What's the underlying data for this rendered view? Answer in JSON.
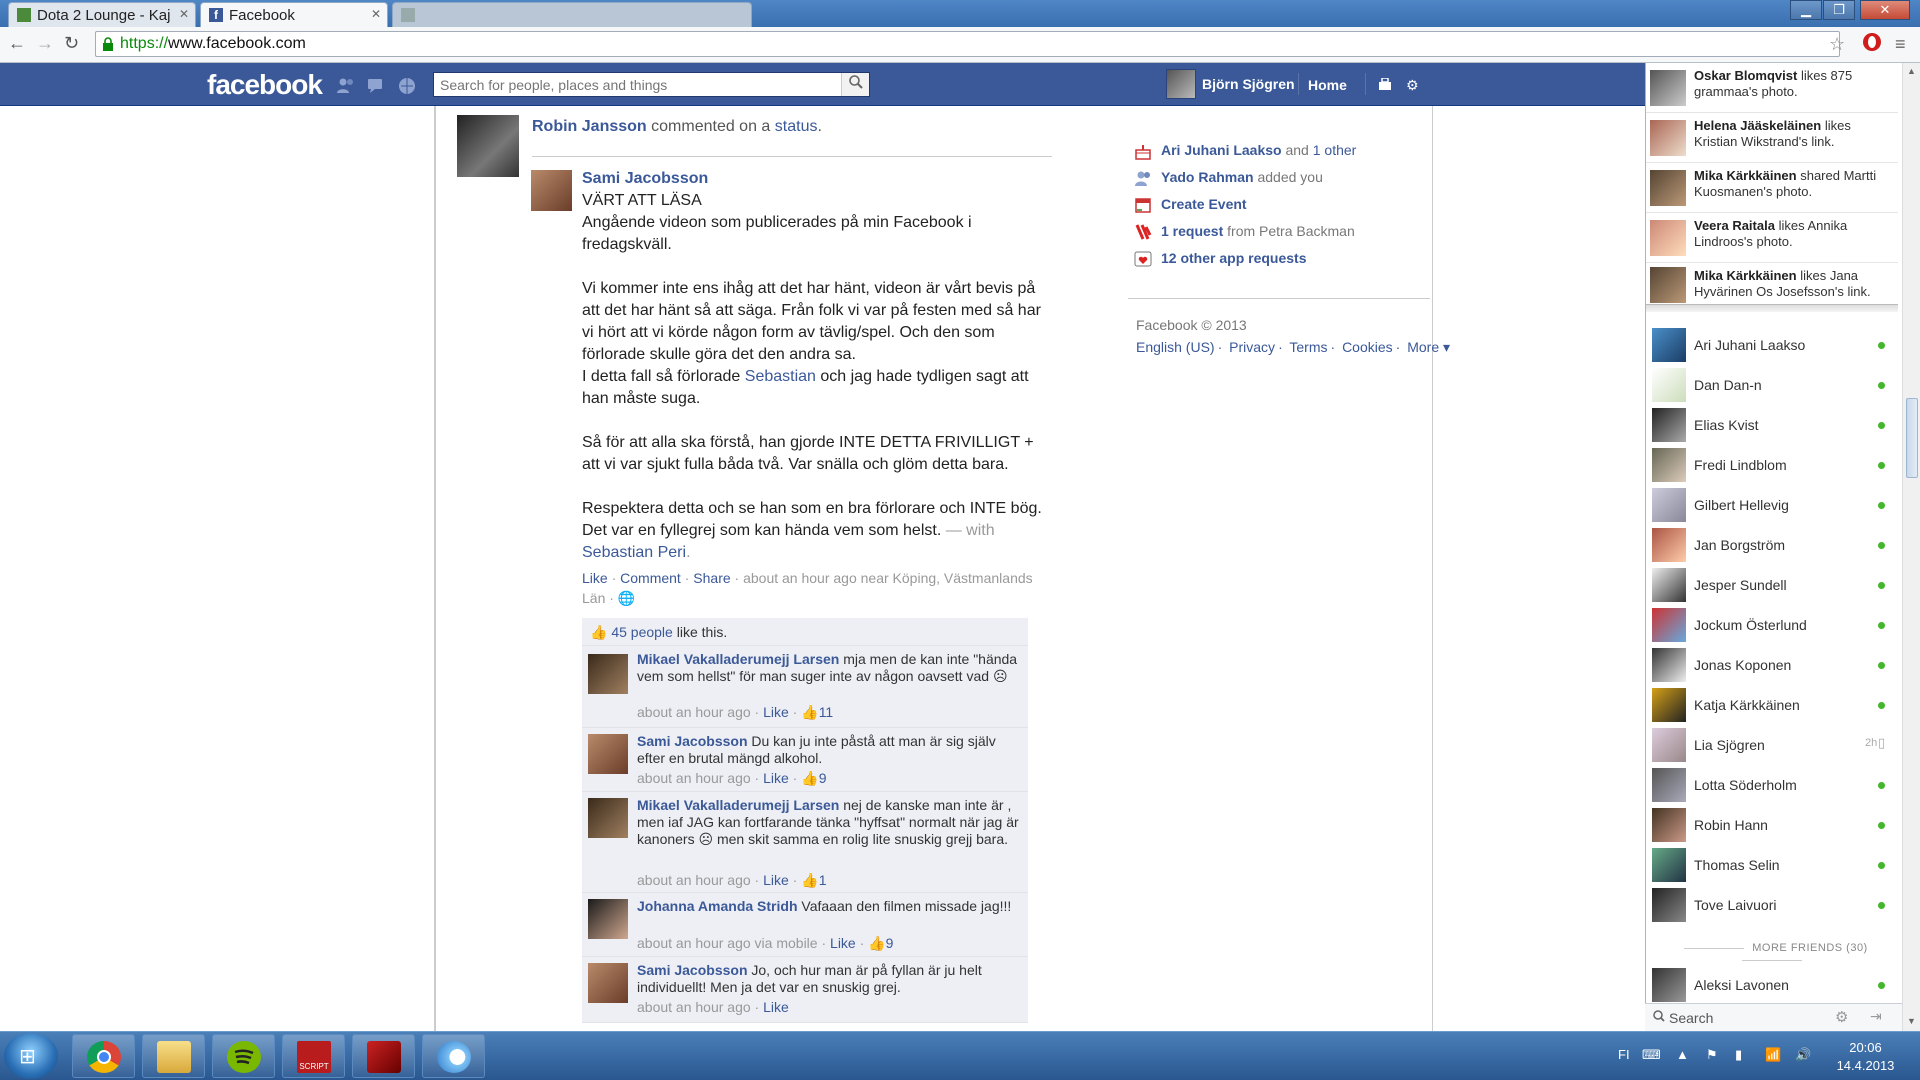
{
  "browser": {
    "tabs": [
      {
        "label": "Dota 2 Lounge - Kaj",
        "active": false
      },
      {
        "label": "Facebook",
        "active": true
      },
      {
        "label": "",
        "active": false
      }
    ],
    "url_scheme": "https://",
    "url_host": "www.facebook.com"
  },
  "fb": {
    "logo": "facebook",
    "search_placeholder": "Search for people, places and things",
    "user_name": "Björn Sjögren",
    "home_label": "Home"
  },
  "story": {
    "actor": "Robin Jansson",
    "action": "commented on a",
    "object": "status",
    "period": "."
  },
  "post": {
    "author": "Sami Jacobsson",
    "line1": "VÄRT ATT LÄSA",
    "para1": "Angående videon som publicerades på min Facebook i fredagskväll.",
    "para2a": "Vi kommer inte ens ihåg att det har hänt, videon är vårt bevis på att det har hänt så att säga. Från folk vi var på festen med så har vi hört att vi körde någon form av tävlig/spel. Och den som förlorade skulle göra det den andra sa.",
    "para2b_pre": "I detta fall så förlorade ",
    "para2b_link": "Sebastian",
    "para2b_post": " och jag hade tydligen sagt att han måste suga.",
    "para3": "Så för att alla ska förstå, han gjorde INTE DETTA FRIVILLIGT + att vi var sjukt fulla båda två. Var snälla och glöm detta bara.",
    "para4": "Respektera detta och se han som en bra förlorare och INTE bög. Det var en fyllegrej som kan hända vem som helst.",
    "with_label": "— with",
    "with_name": "Sebastian Peri",
    "with_end": ".",
    "meta_like": "Like",
    "meta_comment": "Comment",
    "meta_share": "Share",
    "meta_time": "about an hour ago near Köping, Västmanlands Län",
    "likes_count": "45 people",
    "likes_text": "like this."
  },
  "comments": [
    {
      "name": "Mikael Vakalladerumejj Larsen",
      "text": "mja men de kan inte \"hända vem som hellst\" för man suger inte av någon oavsett vad",
      "time": "about an hour ago",
      "like": "Like",
      "likes": "11",
      "via": ""
    },
    {
      "name": "Sami Jacobsson",
      "text": "Du kan ju inte påstå att man är sig själv efter en brutal mängd alkohol.",
      "time": "about an hour ago",
      "like": "Like",
      "likes": "9",
      "via": ""
    },
    {
      "name": "Mikael Vakalladerumejj Larsen",
      "text": "nej de kanske man inte är , men iaf JAG kan fortfarande tänka \"hyffsat\" normalt när jag är kanoners",
      "text2": "men skit samma en rolig lite snuskig grejj bara.",
      "time": "about an hour ago",
      "like": "Like",
      "likes": "1",
      "via": ""
    },
    {
      "name": "Johanna Amanda Stridh",
      "text": "Vafaaan den filmen missade jag!!!",
      "time": "about an hour ago",
      "like": "Like",
      "likes": "9",
      "via": "via mobile"
    },
    {
      "name": "Sami Jacobsson",
      "text": "Jo, och hur man är på fyllan är ju helt individuellt! Men ja det var en snuskig grej.",
      "time": "about an hour ago",
      "like": "Like",
      "likes": "",
      "via": ""
    }
  ],
  "right": {
    "items": [
      {
        "bold": "Ari Juhani Laakso",
        "mid": " and ",
        "bold2": "1 other",
        "rest": ""
      },
      {
        "bold": "Yado Rahman",
        "mid": " added you",
        "bold2": "",
        "rest": ""
      },
      {
        "bold": "Create Event",
        "mid": "",
        "bold2": "",
        "rest": ""
      },
      {
        "bold": "1 request",
        "mid": " from Petra Backman",
        "bold2": "",
        "rest": ""
      },
      {
        "bold": "12 other app requests",
        "mid": "",
        "bold2": "",
        "rest": ""
      }
    ],
    "footer_copy": "Facebook © 2013",
    "footer_links": [
      "English (US)",
      "Privacy",
      "Terms",
      "Cookies",
      "More ▾"
    ]
  },
  "ticker": [
    {
      "name": "Oskar Blomqvist",
      "text": " likes 875 grammaa's photo."
    },
    {
      "name": "Helena Jääskeläinen",
      "text": " likes Kristian Wikstrand's link."
    },
    {
      "name": "Mika Kärkkäinen",
      "text": " shared Martti Kuosmanen's photo."
    },
    {
      "name": "Veera Raitala",
      "text": " likes Annika Lindroos's photo."
    },
    {
      "name": "Mika Kärkkäinen",
      "text": " likes Jana Hyvärinen Os Josefsson's link."
    }
  ],
  "friends": [
    {
      "name": "Ari Juhani Laakso",
      "status": "online",
      "idle": ""
    },
    {
      "name": "Dan Dan-n",
      "status": "online",
      "idle": ""
    },
    {
      "name": "Elias Kvist",
      "status": "online",
      "idle": ""
    },
    {
      "name": "Fredi Lindblom",
      "status": "online",
      "idle": ""
    },
    {
      "name": "Gilbert Hellevig",
      "status": "online",
      "idle": ""
    },
    {
      "name": "Jan Borgström",
      "status": "online",
      "idle": ""
    },
    {
      "name": "Jesper Sundell",
      "status": "online",
      "idle": ""
    },
    {
      "name": "Jockum Österlund",
      "status": "online",
      "idle": ""
    },
    {
      "name": "Jonas Koponen",
      "status": "online",
      "idle": ""
    },
    {
      "name": "Katja Kärkkäinen",
      "status": "online",
      "idle": ""
    },
    {
      "name": "Lia Sjögren",
      "status": "idle",
      "idle": "2h"
    },
    {
      "name": "Lotta Söderholm",
      "status": "online",
      "idle": ""
    },
    {
      "name": "Robin Hann",
      "status": "online",
      "idle": ""
    },
    {
      "name": "Thomas Selin",
      "status": "online",
      "idle": ""
    },
    {
      "name": "Tove Laivuori",
      "status": "online",
      "idle": ""
    }
  ],
  "more_friends": "MORE FRIENDS (30)",
  "more_friend": {
    "name": "Aleksi Lavonen"
  },
  "chat_search": "Search",
  "taskbar": {
    "lang": "FI",
    "time": "20:06",
    "date": "14.4.2013"
  },
  "colors": {
    "fb_blue": "#3b5998",
    "online_green": "#42b72a"
  }
}
